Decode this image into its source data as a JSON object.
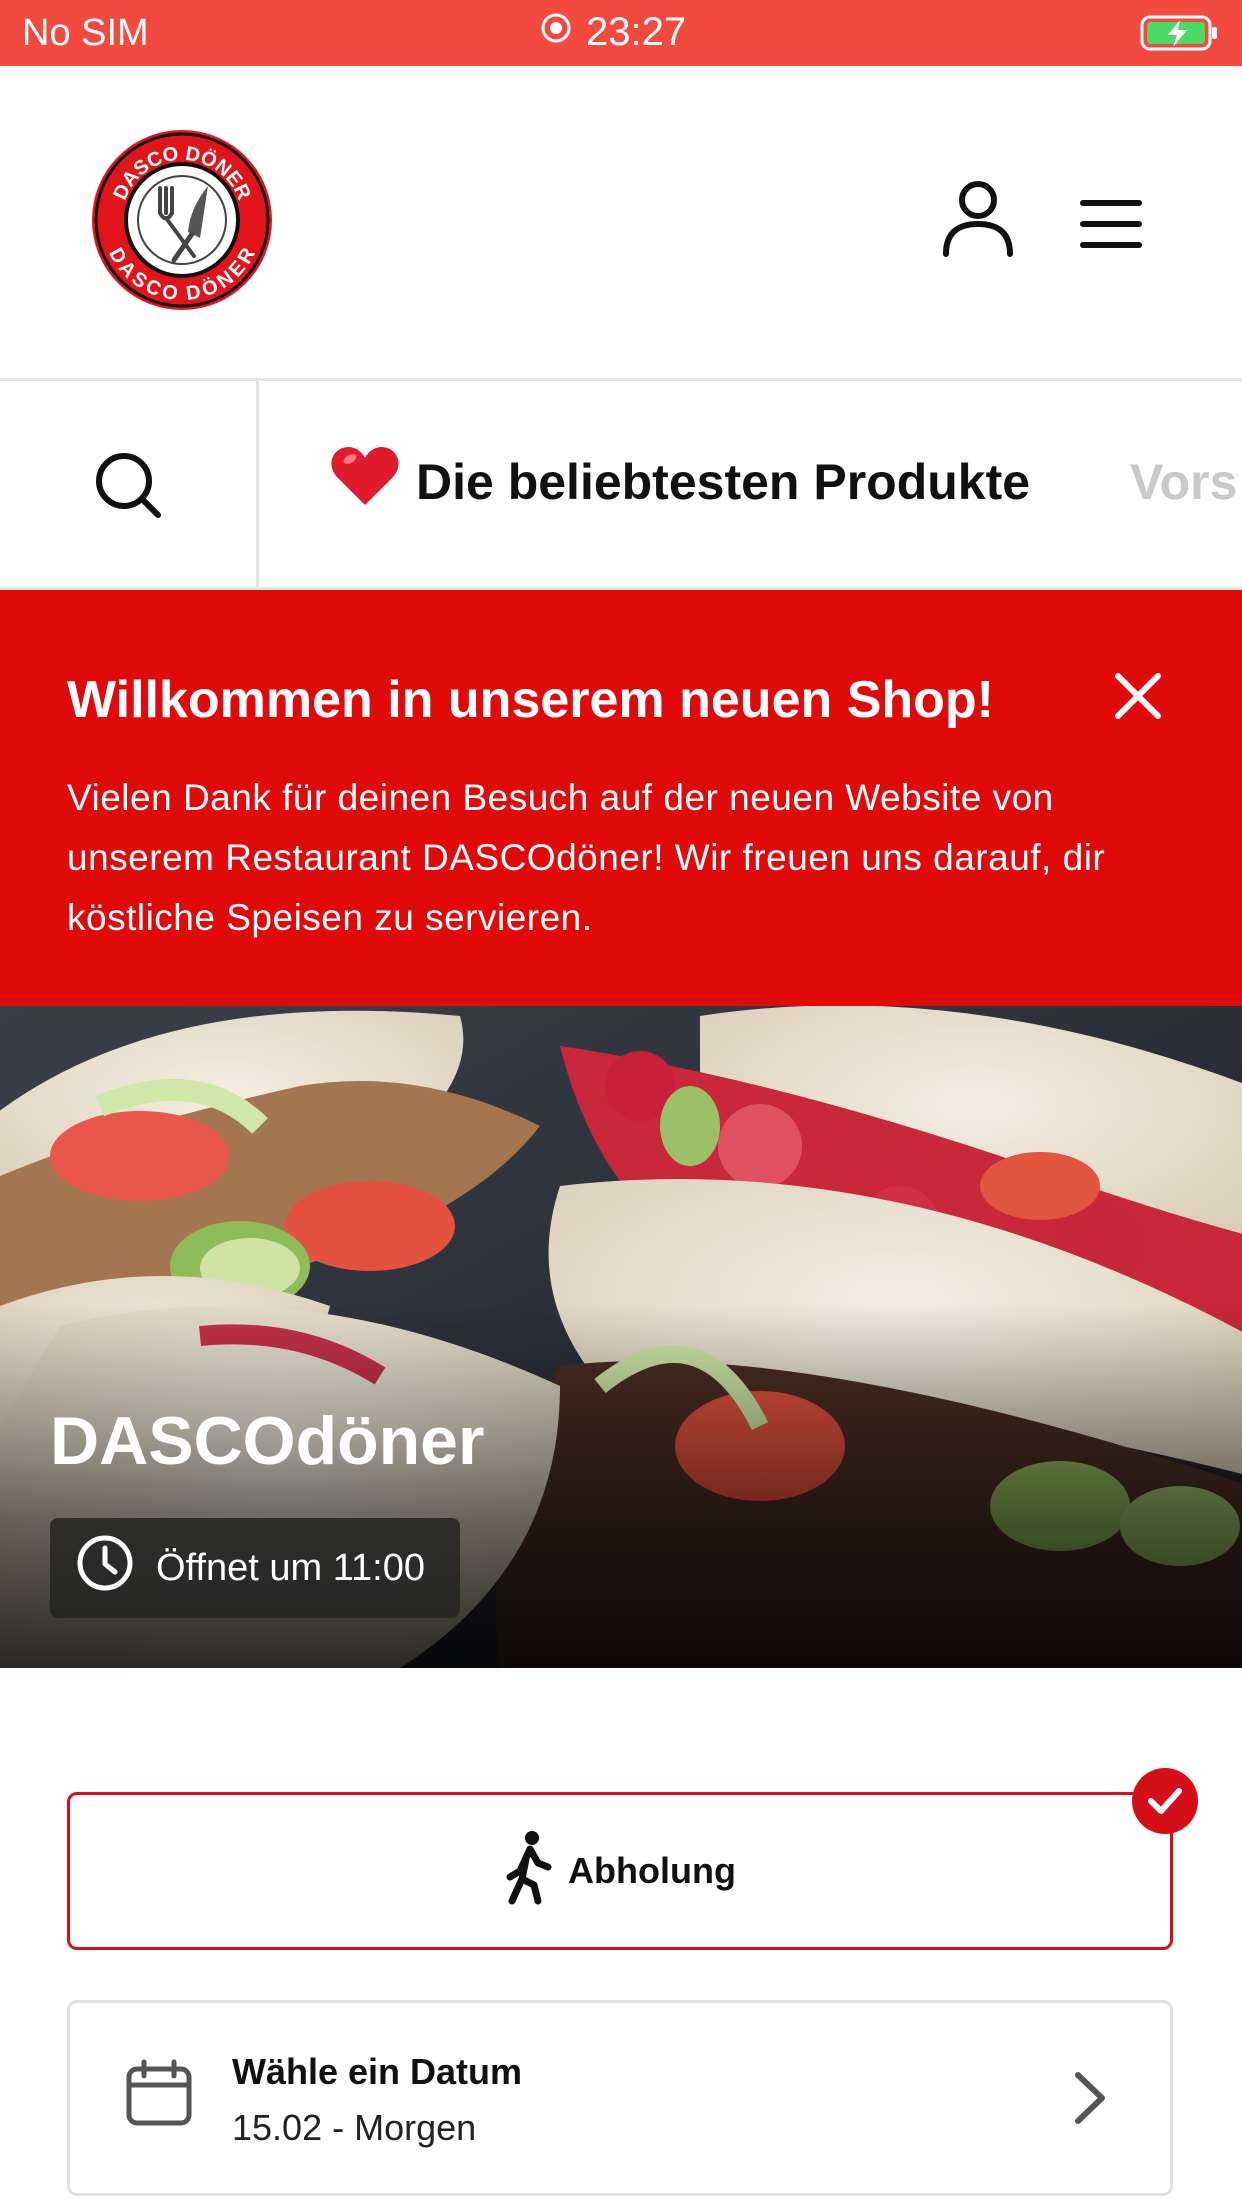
{
  "status_bar": {
    "carrier": "No SIM",
    "time": "23:27",
    "icons": [
      "location-icon",
      "battery-charging-icon"
    ]
  },
  "header": {
    "logo_text": "DASCO DÖNER",
    "icons": [
      "account-icon",
      "menu-icon"
    ]
  },
  "categories": {
    "search_icon": "search-icon",
    "active": {
      "emoji": "❤️",
      "label": "Die beliebtesten Produkte"
    },
    "next": {
      "label": "Vors"
    }
  },
  "banner": {
    "title": "Willkommen in unserem neuen Shop!",
    "text": "Vielen Dank für deinen Besuch auf der neuen Website von unserem Restaurant DASCOdöner! Wir freuen uns darauf, dir köstliche Speisen zu servieren.",
    "close_icon": "close-icon"
  },
  "hero": {
    "title": "DASCOdöner",
    "open_status": "Öffnet um 11:00"
  },
  "order": {
    "pickup_label": "Abholung",
    "pickup_selected": true,
    "date_label": "Wähle ein Datum",
    "date_value": "15.02 - Morgen"
  },
  "colors": {
    "status_bar": "#f34a3f",
    "brand_red": "#e10a0a",
    "accent_red": "#d40f18"
  }
}
